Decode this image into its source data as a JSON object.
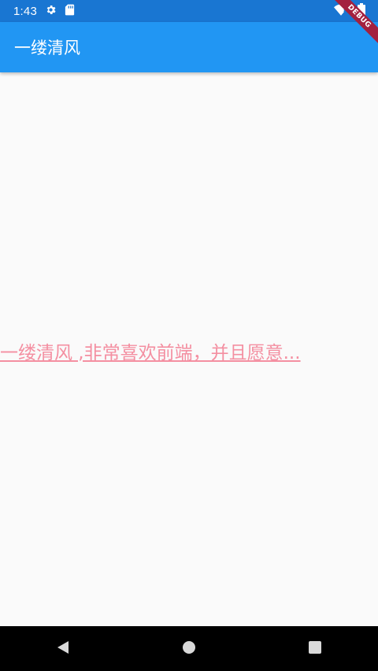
{
  "status_bar": {
    "time": "1:43",
    "icons": [
      "gear-icon",
      "sd-card-icon",
      "wifi-icon",
      "battery-icon"
    ],
    "background": "#1976d2"
  },
  "app_bar": {
    "title": "一缕清风",
    "background": "#2196f3"
  },
  "debug_banner": {
    "label": "DEBUG",
    "color": "#a3213f"
  },
  "content": {
    "text": "一缕清风 ,非常喜欢前端，并且愿意...",
    "text_color": "#f48fa1"
  },
  "nav_bar": {
    "buttons": [
      "back-icon",
      "home-icon",
      "recents-icon"
    ]
  }
}
